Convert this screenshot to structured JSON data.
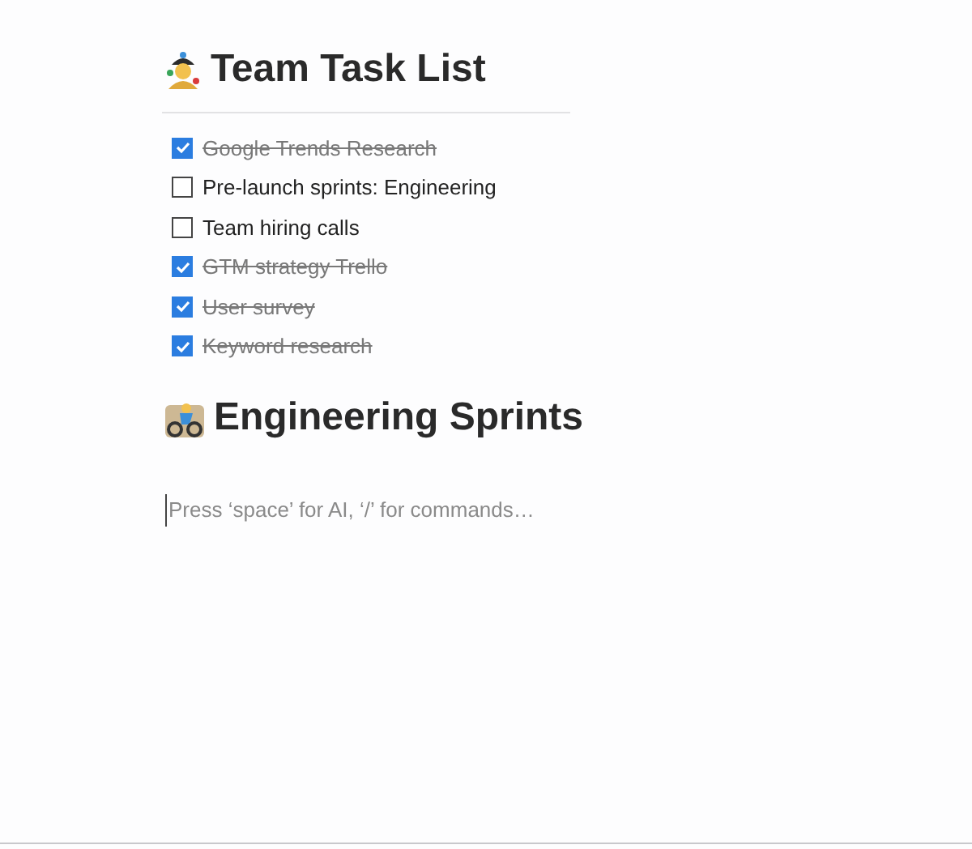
{
  "sections": [
    {
      "title": "Team Task List",
      "tasks": [
        {
          "label": "Google Trends Research",
          "checked": true
        },
        {
          "label": "Pre-launch sprints: Engineering",
          "checked": false
        },
        {
          "label": "Team hiring calls",
          "checked": false
        },
        {
          "label": "GTM strategy Trello",
          "checked": true
        },
        {
          "label": "User survey",
          "checked": true
        },
        {
          "label": "Keyword research",
          "checked": true
        }
      ]
    },
    {
      "title": "Engineering Sprints"
    }
  ],
  "editor": {
    "placeholder": "Press ‘space’ for AI, ‘/’ for commands…"
  }
}
